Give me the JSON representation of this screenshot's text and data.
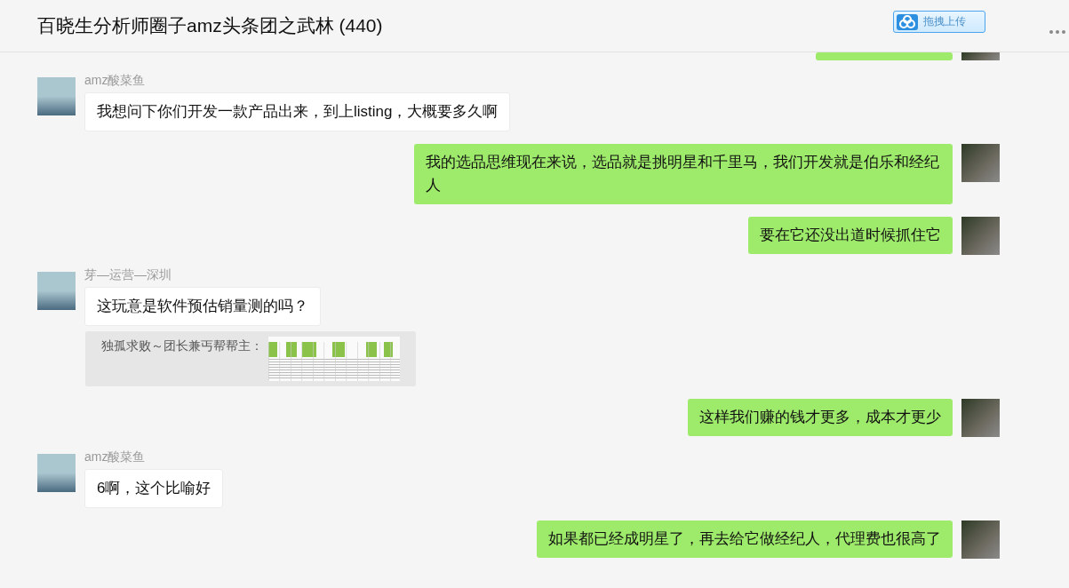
{
  "header": {
    "title": "百晓生分析师圈子amz头条团之武林 (440)",
    "upload_button": "拖拽上传"
  },
  "messages": [
    {
      "kind": "clipped",
      "mine": true
    },
    {
      "kind": "text",
      "mine": false,
      "sender": "amz酸菜鱼",
      "text": "我想问下你们开发一款产品出来，到上listing，大概要多久啊"
    },
    {
      "kind": "text",
      "mine": true,
      "text": "我的选品思维现在来说，选品就是挑明星和千里马，我们开发就是伯乐和经纪人"
    },
    {
      "kind": "text",
      "mine": true,
      "text": "要在它还没出道时候抓住它"
    },
    {
      "kind": "text",
      "mine": false,
      "sender": "芽—运营—深圳",
      "text": "这玩意是软件预估销量测的吗？"
    },
    {
      "kind": "quote",
      "mine": false,
      "text": "独孤求败～团长兼丐帮帮主："
    },
    {
      "kind": "text",
      "mine": true,
      "text": "这样我们赚的钱才更多，成本才更少"
    },
    {
      "kind": "text",
      "mine": false,
      "sender": "amz酸菜鱼",
      "text": "6啊，这个比喻好"
    },
    {
      "kind": "text",
      "mine": true,
      "text": "如果都已经成明星了，再去给它做经纪人，代理费也很高了"
    }
  ]
}
